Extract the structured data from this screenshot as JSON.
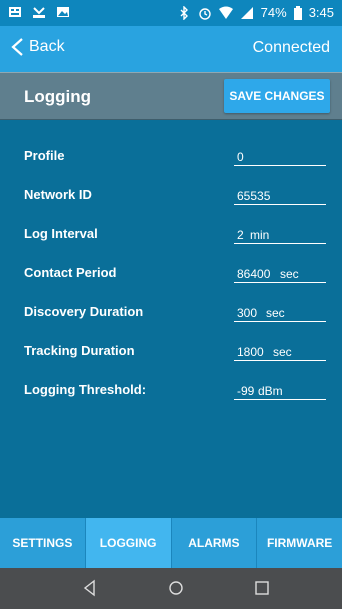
{
  "status": {
    "battery_percent": "74%",
    "time": "3:45"
  },
  "topbar": {
    "back_label": "Back",
    "connection_status": "Connected"
  },
  "section": {
    "title": "Logging",
    "save_label": "SAVE CHANGES"
  },
  "fields": [
    {
      "label": "Profile",
      "value": "0",
      "unit": ""
    },
    {
      "label": "Network ID",
      "value": "65535",
      "unit": ""
    },
    {
      "label": "Log Interval",
      "value": "2",
      "unit": "min"
    },
    {
      "label": "Contact Period",
      "value": "86400",
      "unit": "sec"
    },
    {
      "label": "Discovery Duration",
      "value": "300",
      "unit": "sec"
    },
    {
      "label": "Tracking Duration",
      "value": "1800",
      "unit": "sec"
    },
    {
      "label": "Logging Threshold:",
      "value": "-99",
      "unit": "dBm"
    }
  ],
  "tabs": [
    {
      "label": "SETTINGS"
    },
    {
      "label": "LOGGING"
    },
    {
      "label": "ALARMS"
    },
    {
      "label": "FIRMWARE"
    }
  ],
  "colors": {
    "primary": "#29a3e0",
    "background": "#0a6f99",
    "header": "#5f7f8e",
    "tab_active": "#42b6ef"
  }
}
